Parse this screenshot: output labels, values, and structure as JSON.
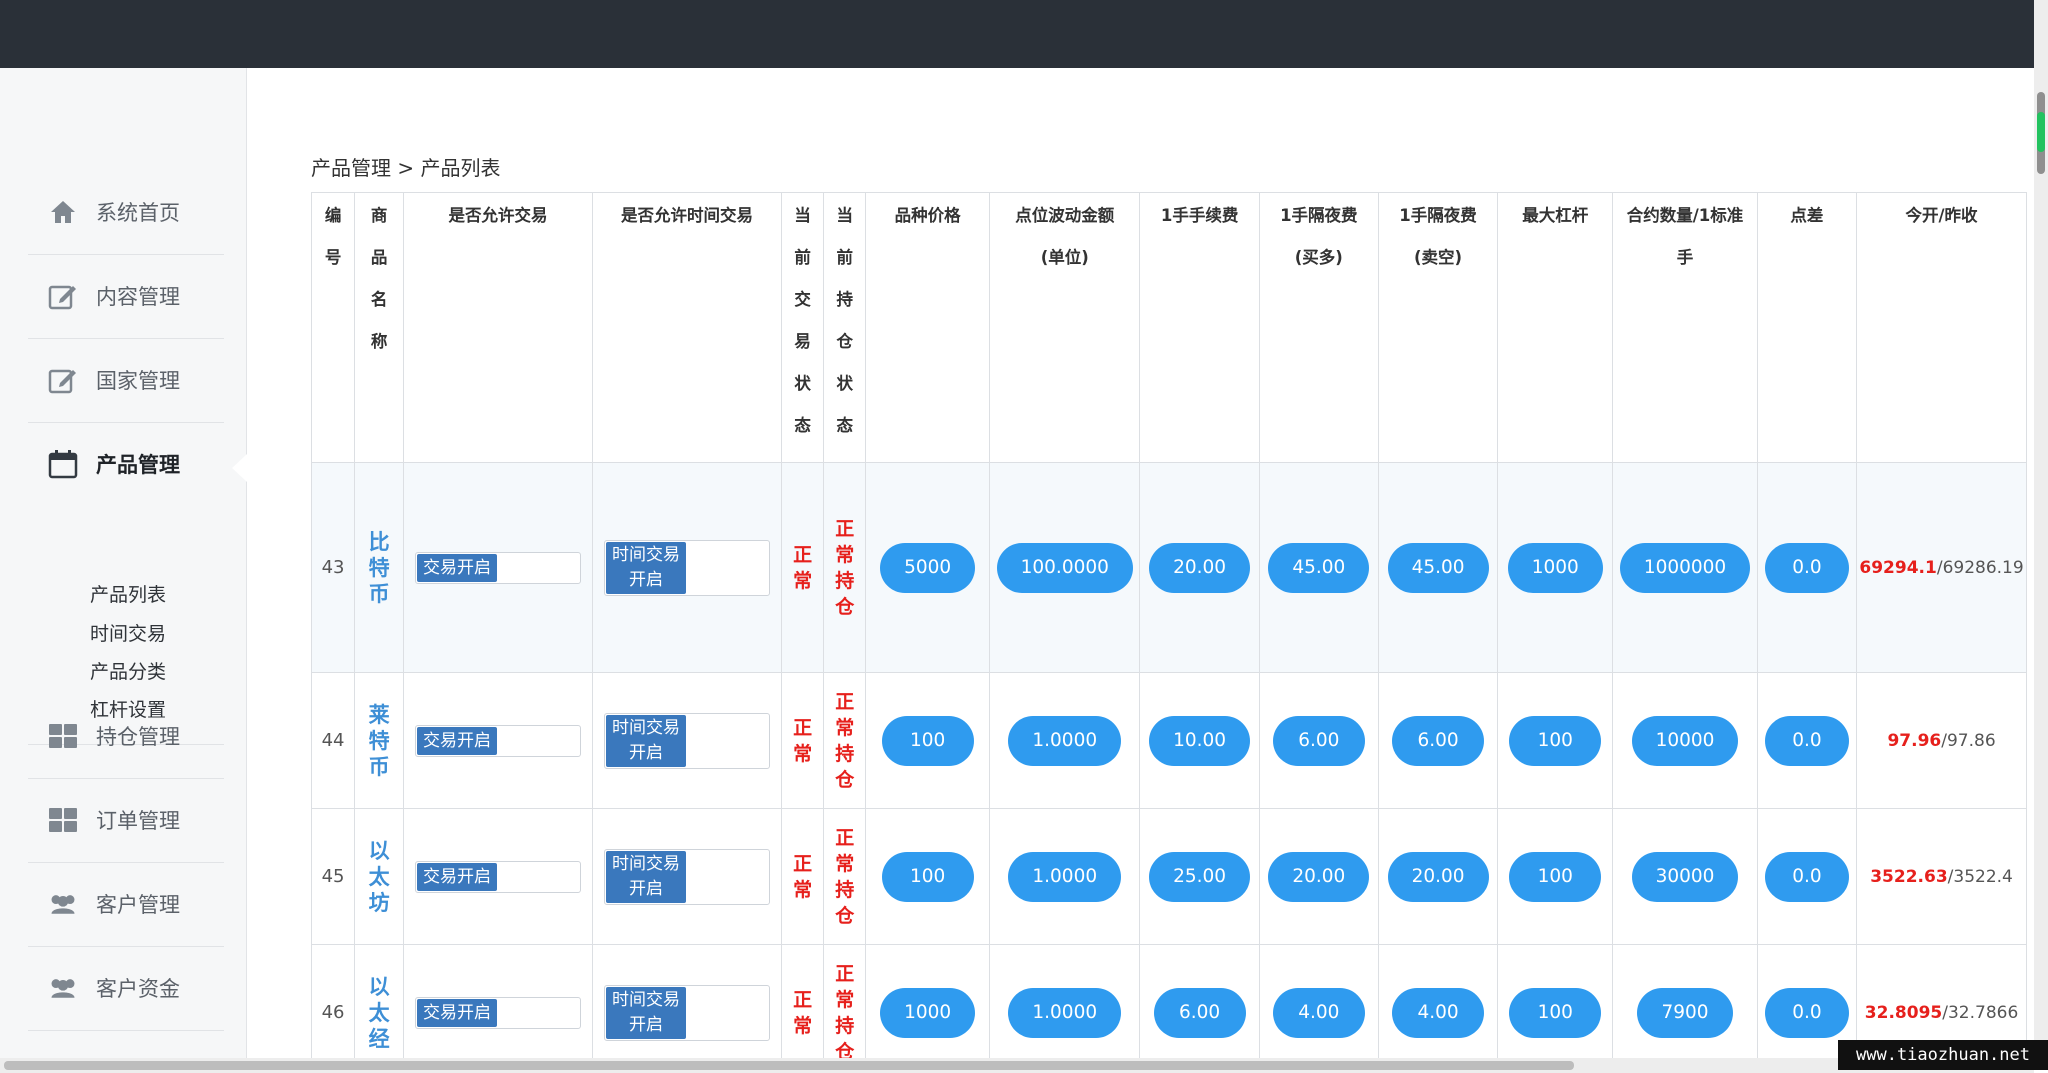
{
  "sidebar": {
    "items": [
      {
        "label": "系统首页",
        "icon": "home-icon"
      },
      {
        "label": "内容管理",
        "icon": "edit-icon"
      },
      {
        "label": "国家管理",
        "icon": "edit-icon"
      },
      {
        "label": "产品管理",
        "icon": "calendar-icon",
        "active": true
      },
      {
        "label": "持仓管理",
        "icon": "grid-icon"
      },
      {
        "label": "订单管理",
        "icon": "grid-icon"
      },
      {
        "label": "客户管理",
        "icon": "users-icon"
      },
      {
        "label": "客户资金",
        "icon": "users-icon"
      }
    ],
    "submenu": [
      "产品列表",
      "时间交易",
      "产品分类",
      "杠杆设置"
    ]
  },
  "breadcrumb": "产品管理 > 产品列表",
  "table": {
    "headers": [
      "编号",
      "商品名称",
      "是否允许交易",
      "是否允许时间交易",
      "当前交易状态",
      "当前持仓状态",
      "品种价格",
      "点位波动金额(单位)",
      "1手手续费",
      "1手隔夜费(买多)",
      "1手隔夜费(卖空)",
      "最大杠杆",
      "合约数量/1标准手",
      "点差",
      "今开/昨收"
    ],
    "toggle_label": "交易开启",
    "time_toggle_label": [
      "时间交易",
      "开启"
    ],
    "rows": [
      {
        "id": "43",
        "name": "比特币",
        "trade_status": "正常",
        "position_status": "正常持仓",
        "price": "5000",
        "tick_value": "100.0000",
        "fee": "20.00",
        "overnight_long": "45.00",
        "overnight_short": "45.00",
        "max_leverage": "1000",
        "contract_size": "1000000",
        "spread": "0.0",
        "open": "69294.1",
        "prev_close": "69286.19"
      },
      {
        "id": "44",
        "name": "莱特币",
        "trade_status": "正常",
        "position_status": "正常持仓",
        "price": "100",
        "tick_value": "1.0000",
        "fee": "10.00",
        "overnight_long": "6.00",
        "overnight_short": "6.00",
        "max_leverage": "100",
        "contract_size": "10000",
        "spread": "0.0",
        "open": "97.96",
        "prev_close": "97.86"
      },
      {
        "id": "45",
        "name": "以太坊",
        "trade_status": "正常",
        "position_status": "正常持仓",
        "price": "100",
        "tick_value": "1.0000",
        "fee": "25.00",
        "overnight_long": "20.00",
        "overnight_short": "20.00",
        "max_leverage": "100",
        "contract_size": "30000",
        "spread": "0.0",
        "open": "3522.63",
        "prev_close": "3522.4"
      },
      {
        "id": "46",
        "name": "以太经",
        "trade_status": "正常",
        "position_status": "正常持仓",
        "price": "1000",
        "tick_value": "1.0000",
        "fee": "6.00",
        "overnight_long": "4.00",
        "overnight_short": "4.00",
        "max_leverage": "100",
        "contract_size": "7900",
        "spread": "0.0",
        "open": "32.8095",
        "prev_close": "32.7866"
      }
    ]
  },
  "watermark": "www.tiaozhuan.net",
  "colors": {
    "topbar": "#2a3038",
    "pill": "#2f9bef",
    "toggle": "#3a78bd",
    "status_red": "#e6201c",
    "name_blue": "#3e8fd6"
  }
}
